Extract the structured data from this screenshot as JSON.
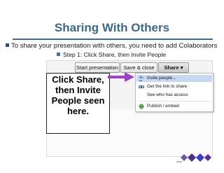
{
  "slide": {
    "title": "Sharing With Others",
    "bullet1": "To share your presentation with others, you need to add Colaborators",
    "bullet2": "Step 1: Click Share, then Invite People"
  },
  "toolbar": {
    "start_label": "Start presentation",
    "save_label": "Save & close",
    "share_label": "Share",
    "share_caret": "▾"
  },
  "share_menu": {
    "items": [
      {
        "label": "Invite people...",
        "icon": "people-icon"
      },
      {
        "label": "Get the link to share",
        "icon": "link-icon"
      },
      {
        "label": "See who has access",
        "icon": ""
      },
      {
        "label": "Publish / embed",
        "icon": "globe-icon"
      }
    ]
  },
  "callout": {
    "lines": [
      "Click Share,",
      "then Invite",
      "People seen",
      "here."
    ]
  },
  "colors": {
    "title": "#3b6a8a",
    "rule": "#3c6aa6",
    "arrow": "#a040c8",
    "logo": "#4b2f8c"
  }
}
